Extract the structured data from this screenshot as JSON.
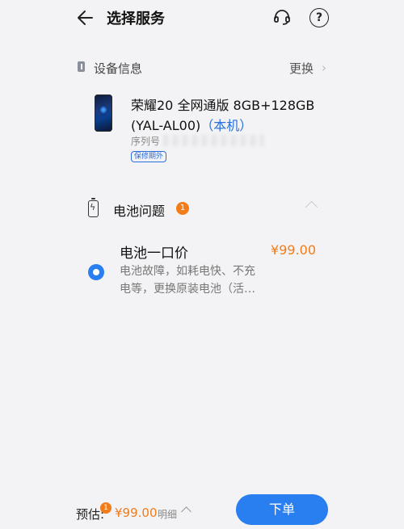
{
  "header": {
    "title": "选择服务",
    "back_icon": "arrow-left-icon",
    "support_icon": "headset-icon",
    "help_label": "?"
  },
  "device": {
    "section_title": "设备信息",
    "change_label": "更换",
    "change_chevron": "›",
    "name": "荣耀20 全网通版 8GB+128GB (YAL-AL00)",
    "local_tag": "（本机）",
    "serial_label": "序列号",
    "warranty": "保修期外"
  },
  "issue": {
    "title": "电池问题",
    "count": "1",
    "service": {
      "name": "电池一口价",
      "price": "¥99.00",
      "description": "电池故障，如耗电快、不充\n电等，更换原装电池（活…",
      "selected": true
    }
  },
  "footer": {
    "estimate_label": "预估:",
    "estimate_badge": "1",
    "estimate_price": "¥99.00",
    "detail_label": "明细",
    "order_label": "下单"
  },
  "colors": {
    "accent": "#2a7ff0",
    "price": "#f27c19",
    "background": "#f3f3f5"
  }
}
